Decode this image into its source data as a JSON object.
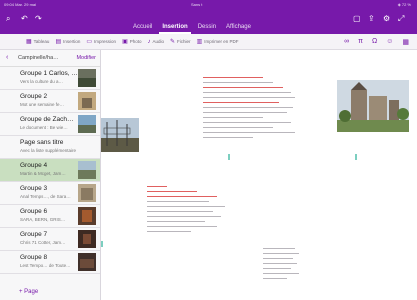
{
  "status": {
    "left": "09:04  Mar. 29 mai",
    "center": "Sans t",
    "right": "◈ 72 %"
  },
  "toolbar": {
    "search_icon": "search-icon",
    "undo_icon": "undo-icon",
    "redo_icon": "redo-icon"
  },
  "tabs": [
    "Accueil",
    "Insertion",
    "Dessin",
    "Affichage"
  ],
  "ribbon": {
    "items": [
      "Tableau",
      "Insertion",
      "Impression",
      "Photo",
      "Audio",
      "Fichier",
      "Imprimer en PDF"
    ]
  },
  "sidebar": {
    "back": "‹",
    "title": "Campinelle/ha…",
    "edit": "Modifier",
    "items": [
      {
        "title": "Groupe 1 Carlos, …",
        "sub": "Vers la culture du a…"
      },
      {
        "title": "Groupe 2",
        "sub": "Mot une semaine fe…"
      },
      {
        "title": "Groupe de Zach…",
        "sub": "Le document : Be wie…"
      },
      {
        "title": "Page sans titre",
        "sub": "Avec la liste supplémentaire"
      },
      {
        "title": "Groupe 4",
        "sub": "Martin & Mcget, Jam…"
      },
      {
        "title": "Groupe 3",
        "sub": "Anal Temps…, de Sara…"
      },
      {
        "title": "Groupe 6",
        "sub": "SARA, BERN, GRIS…"
      },
      {
        "title": "Groupe 7",
        "sub": "Chris 71 Cotter, Jam…"
      },
      {
        "title": "Groupe 8",
        "sub": "Lest Tempo… de Toute…"
      }
    ],
    "add": "+  Page"
  },
  "colors": {
    "brand": "#7719aa",
    "selected": "#c9dfc0"
  }
}
